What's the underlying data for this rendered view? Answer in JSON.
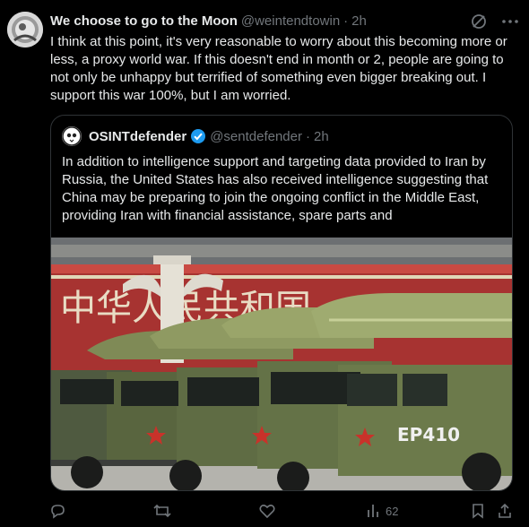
{
  "tweet": {
    "author_name": "We choose to go to the Moon",
    "author_handle": "@weintendtowin",
    "separator": "·",
    "time": "2h",
    "text": "I think at this point, it's very reasonable to worry about this becoming more or less, a proxy world war. If this doesn't end in month or 2, people are going to not only be unhappy but terrified of something even bigger breaking out. I support this war 100%, but I am worried."
  },
  "quote": {
    "author_name": "OSINTdefender",
    "author_handle": "@sentdefender",
    "separator": "·",
    "time": "2h",
    "text": "In addition to intelligence support and targeting data provided to Iran by Russia, the United States has also received intelligence suggesting that China may be preparing to join the ongoing conflict in the Middle East, providing Iran with financial assistance, spare parts and",
    "image": {
      "sign_text": "中华人民共和国",
      "vehicle_code": "EP410"
    }
  },
  "actions": {
    "reply_icon": "reply-icon",
    "retweet_icon": "retweet-icon",
    "like_icon": "like-icon",
    "views_icon": "views-icon",
    "views_count": "62",
    "bookmark_icon": "bookmark-icon",
    "share_icon": "share-icon"
  },
  "colors": {
    "background": "#000000",
    "text": "#e7e9ea",
    "muted": "#71767b",
    "border": "#2f3336",
    "verified": "#1d9bf0"
  }
}
